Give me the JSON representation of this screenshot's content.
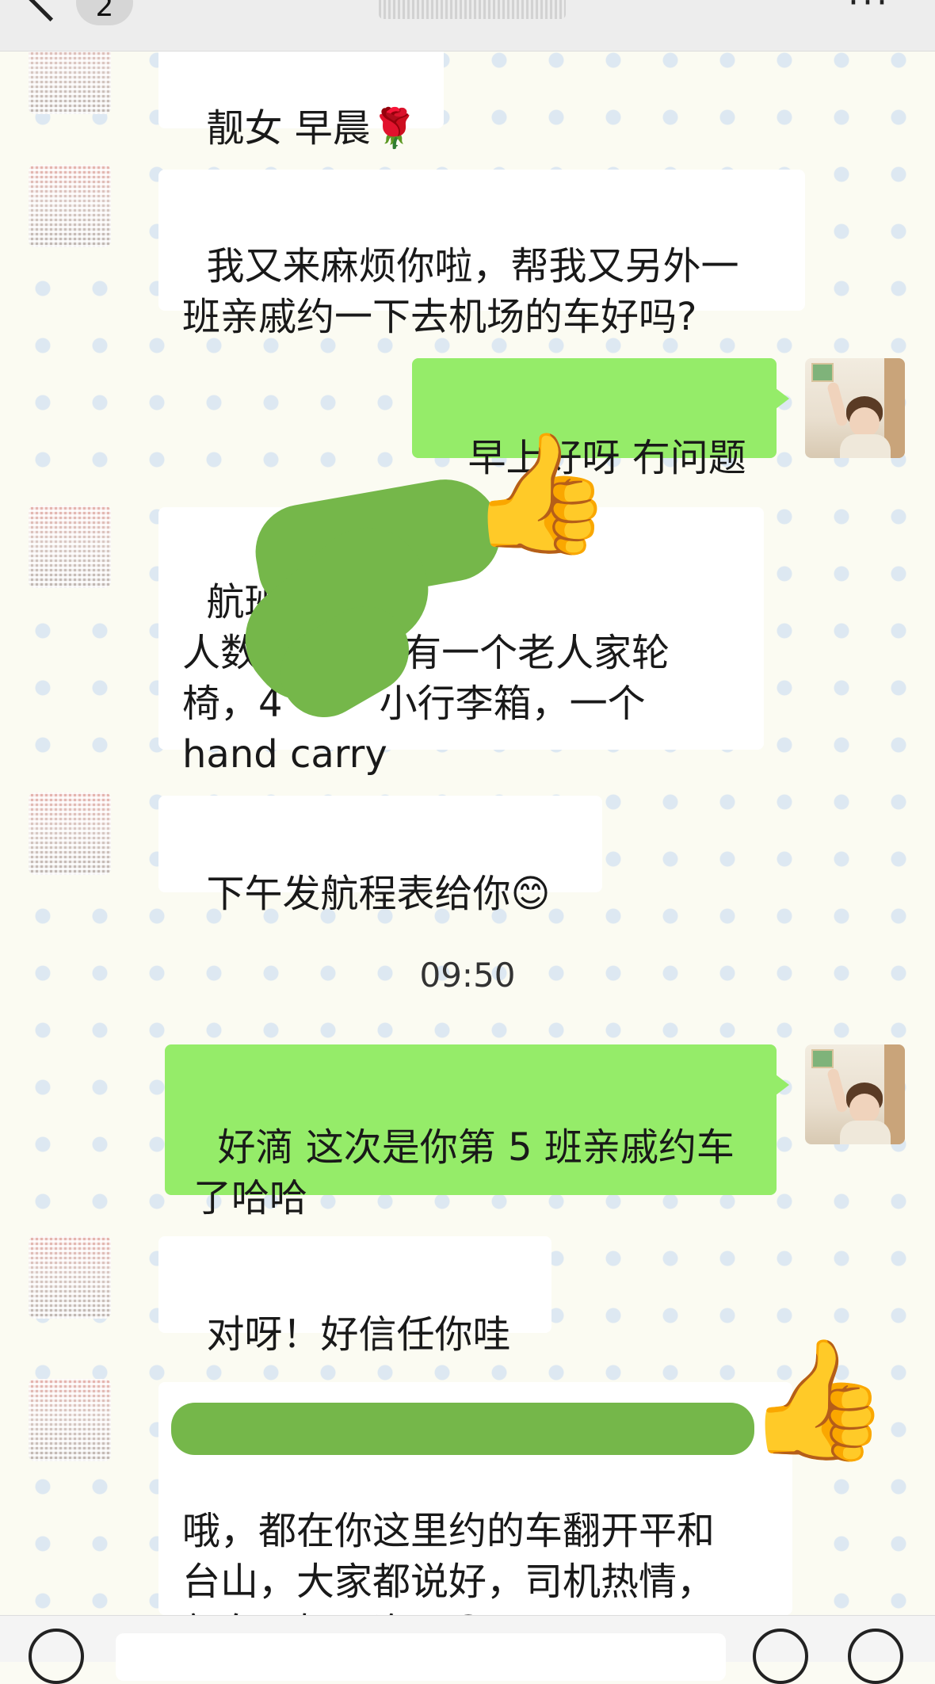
{
  "header": {
    "badge_count": "2",
    "more": "···"
  },
  "messages": [
    {
      "side": "left",
      "text": "靓女 早晨🌹"
    },
    {
      "side": "left",
      "text": "我又来麻烦你啦，帮我又另外一\n班亲戚约一下去机场的车好吗?"
    },
    {
      "side": "right",
      "text": "早上好呀 冇问题"
    },
    {
      "side": "left",
      "text": "航班\n人数 1         有一个老人家轮\n椅，4        小行李箱，一个\nhand carry"
    },
    {
      "side": "left",
      "text": "下午发航程表给你😊"
    },
    {
      "side": "right",
      "text": "好滴 这次是你第 5 班亲戚约车\n了哈哈"
    },
    {
      "side": "left",
      "text": "对呀！好信任你哇"
    },
    {
      "side": "left",
      "text": "\n哦，都在你这里约的车翻开平和\n台山，大家都说好，司机热情，\n部车又好干净！😁"
    }
  ],
  "timestamp": "09:50",
  "stickers": {
    "thumb": "👍"
  }
}
